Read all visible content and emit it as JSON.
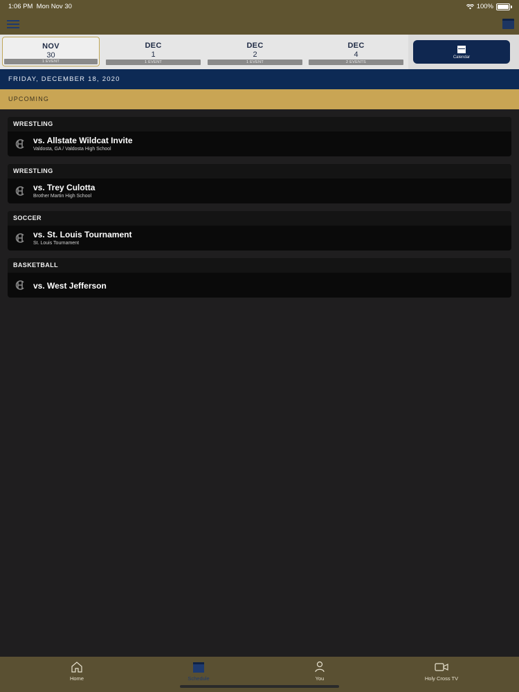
{
  "status": {
    "time": "1:06 PM",
    "date": "Mon Nov 30",
    "battery": "100%"
  },
  "dates": [
    {
      "month": "NOV",
      "day": "30",
      "events": "1 EVENT",
      "active": true
    },
    {
      "month": "DEC",
      "day": "1",
      "events": "1 EVENT",
      "active": false
    },
    {
      "month": "DEC",
      "day": "2",
      "events": "1 EVENT",
      "active": false
    },
    {
      "month": "DEC",
      "day": "4",
      "events": "2 EVENTS",
      "active": false
    }
  ],
  "calendar_button": {
    "label": "Calendar"
  },
  "date_header": "FRIDAY, DECEMBER 18, 2020",
  "section_label": "UPCOMING",
  "events": [
    {
      "sport": "WRESTLING",
      "opponent": "vs. Allstate Wildcat Invite",
      "venue": "Valdosta, GA / Valdosta High School"
    },
    {
      "sport": "WRESTLING",
      "opponent": "vs. Trey Culotta",
      "venue": "Brother Martin High School"
    },
    {
      "sport": "SOCCER",
      "opponent": "vs. St. Louis Tournament",
      "venue": "St. Louis Tournament"
    },
    {
      "sport": "BASKETBALL",
      "opponent": "vs. West Jefferson",
      "venue": ""
    }
  ],
  "tabs": [
    {
      "label": "Home",
      "icon": "home-icon"
    },
    {
      "label": "Schedule",
      "icon": "calendar-icon"
    },
    {
      "label": "You",
      "icon": "person-icon"
    },
    {
      "label": "Holy Cross TV",
      "icon": "video-camera-icon"
    }
  ],
  "colors": {
    "header_gold": "#5f5430",
    "navy": "#0d2a55",
    "accent_gold": "#c9a554",
    "background": "#1f1e1f"
  }
}
